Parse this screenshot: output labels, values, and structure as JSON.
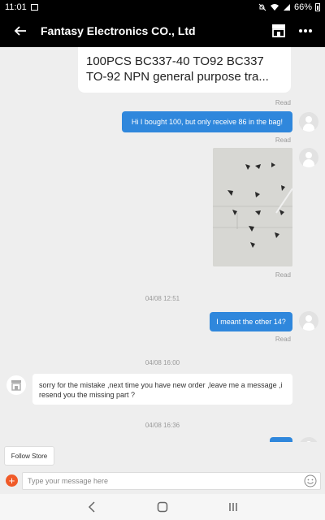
{
  "status_bar": {
    "time": "11:01",
    "battery": "66%"
  },
  "header": {
    "title": "Fantasy Electronics CO., Ltd"
  },
  "product": {
    "line1": "100PCS BC337-40 TO92 BC337",
    "line2": "TO-92 NPN general purpose tra..."
  },
  "messages": {
    "read_label": "Read",
    "m1": "Hi I bought 100, but only receive 86 in the bag!",
    "ts1": "04/08 12:51",
    "m2": "I meant the other 14?",
    "ts2": "04/08 16:00",
    "m3": "sorry for the mistake ,next time you have new order ,leave me a message ,i resend you the missing part ?",
    "ts3": "04/08 16:36"
  },
  "footer": {
    "follow_label": "Follow Store",
    "input_placeholder": "Type your message here"
  },
  "colors": {
    "accent": "#2f87dc",
    "plus": "#f05a28"
  }
}
